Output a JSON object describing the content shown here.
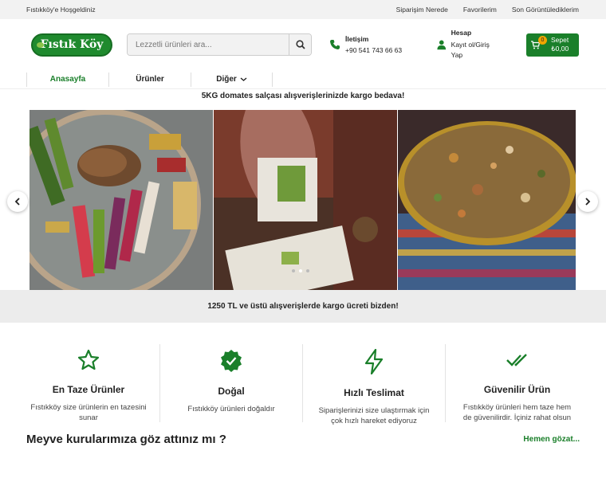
{
  "topbar": {
    "welcome": "Fıstıkköy'e Hoşgeldiniz",
    "links": [
      "Siparişim Nerede",
      "Favorilerim",
      "Son Görüntülediklerim"
    ]
  },
  "header": {
    "logo_text": "Fıstık Köy",
    "search_placeholder": "Lezzetli ürünleri ara...",
    "contact_title": "İletişim",
    "contact_phone": "+90 541 743 66 63",
    "account_title": "Hesap",
    "account_sub": "Kayıt ol/Giriş Yap",
    "cart_count": "0",
    "cart_label": "Sepet",
    "cart_total": "₺0,00"
  },
  "nav": {
    "items": [
      "Anasayfa",
      "Ürünler",
      "Diğer"
    ]
  },
  "promo_top": "5KG domates salçası alışverişlerinizde kargo bedava!",
  "promo_bar": "1250 TL ve üstü alışverişlerde kargo ücreti bizden!",
  "slider": {
    "slides": [
      "baklava-assortment-tray",
      "pistachio-dessert-cutting",
      "herbal-tea-mix-plate"
    ],
    "active_dot": 1,
    "dot_count": 3
  },
  "features": [
    {
      "icon": "star-icon",
      "title": "En Taze Ürünler",
      "desc": "Fıstıkköy size ürünlerin en tazesini sunar"
    },
    {
      "icon": "verified-badge-icon",
      "title": "Doğal",
      "desc": "Fıstıkköy ürünleri doğaldır"
    },
    {
      "icon": "lightning-icon",
      "title": "Hızlı Teslimat",
      "desc": "Siparişlerinizi size ulaştırmak için çok hızlı hareket ediyoruz"
    },
    {
      "icon": "double-check-icon",
      "title": "Güvenilir Ürün",
      "desc": "Fıstıkköy ürünleri hem taze hem de güvenilirdir. İçiniz rahat olsun"
    }
  ],
  "section": {
    "title": "Meyve kurularımıza göz attınız mı ?",
    "more": "Hemen gözat..."
  },
  "colors": {
    "brand_green": "#1a7f2a",
    "badge_orange": "#f0a500"
  }
}
